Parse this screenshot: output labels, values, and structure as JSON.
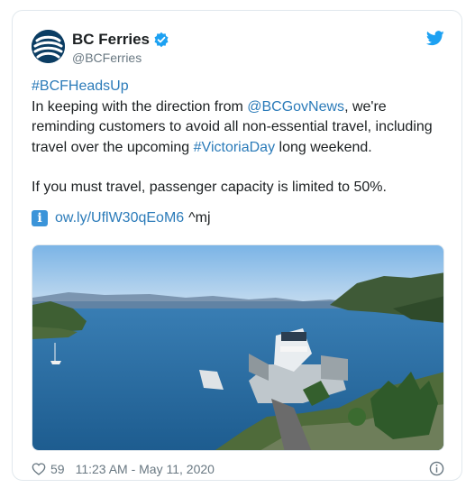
{
  "tweet": {
    "display_name": "BC Ferries",
    "handle": "@BCFerries",
    "hashtag_heads_up": "#BCFHeadsUp",
    "text_line1_pre": "In keeping with the direction from ",
    "mention": "@BCGovNews",
    "text_line1_post": ", we're",
    "text_line2": "reminding customers to avoid all non-essential travel, including",
    "text_line3_pre": "travel over the upcoming ",
    "hashtag_victoria": "#VictoriaDay",
    "text_line3_post": " long weekend.",
    "text_paragraph2": "If you must travel, passenger capacity is limited to 50%.",
    "link_text": "ow.ly/UflW30qEoM6",
    "link_suffix": "^mj",
    "info_icon_glyph": "i"
  },
  "footer": {
    "like_count": "59",
    "timestamp": "11:23 AM - May 11, 2020"
  },
  "colors": {
    "link": "#2b7bb9",
    "twitter_blue": "#1da1f2",
    "verified_blue": "#1da1f2",
    "muted_text": "#697882",
    "logo_background": "#0b3d63"
  },
  "icons": {
    "avatar": "bc-ferries-logo",
    "verified": "verified-badge-icon",
    "brand": "twitter-bird-icon",
    "like": "heart-icon",
    "info": "info-circle-icon"
  }
}
